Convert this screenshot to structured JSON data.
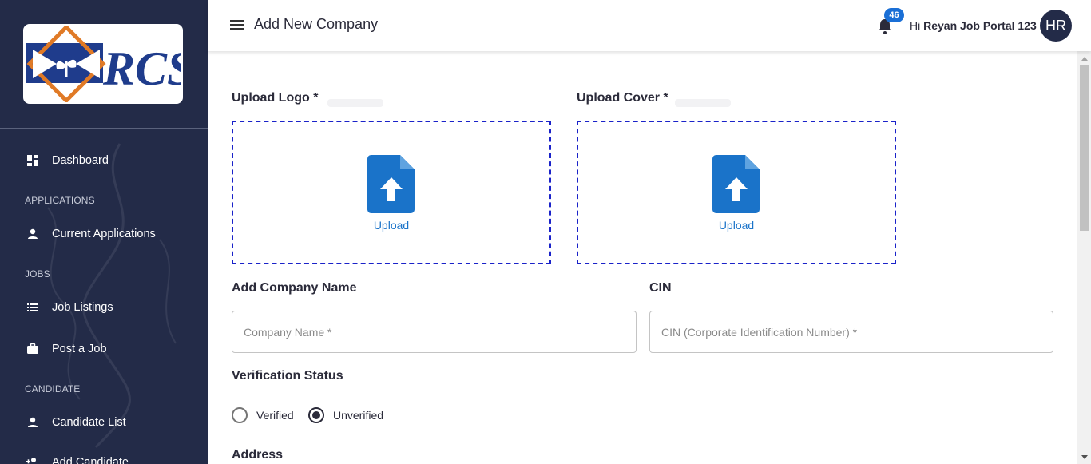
{
  "app": {
    "logo_text": "RCS"
  },
  "sidebar": {
    "items": [
      {
        "label": "Dashboard",
        "icon": "dashboard-icon"
      },
      {
        "label": "Current Applications",
        "icon": "person-icon"
      },
      {
        "label": "Job Listings",
        "icon": "list-icon"
      },
      {
        "label": "Post a Job",
        "icon": "briefcase-icon"
      },
      {
        "label": "Candidate List",
        "icon": "person-icon"
      },
      {
        "label": "Add Candidate",
        "icon": "person-add-icon"
      }
    ],
    "sections": [
      "APPLICATIONS",
      "JOBS",
      "CANDIDATE"
    ]
  },
  "header": {
    "title": "Add New Company",
    "notification_count": "46",
    "greeting_prefix": "Hi ",
    "user_name": "Reyan Job Portal 123",
    "avatar_initials": "HR"
  },
  "form": {
    "upload_logo_label": "Upload Logo *",
    "upload_cover_label": "Upload Cover *",
    "upload_text": "Upload",
    "company_name_label": "Add Company Name",
    "company_name_placeholder": "Company Name *",
    "cin_label": "CIN",
    "cin_placeholder": "CIN (Corporate Identification Number) *",
    "verification_label": "Verification Status",
    "verification_options": [
      "Verified",
      "Unverified"
    ],
    "verification_selected": "Unverified",
    "address_label": "Address"
  },
  "colors": {
    "sidebar_bg": "#232b48",
    "accent": "#1a73c9",
    "dashed_border": "#1a22c9",
    "badge": "#1a6fd6"
  }
}
